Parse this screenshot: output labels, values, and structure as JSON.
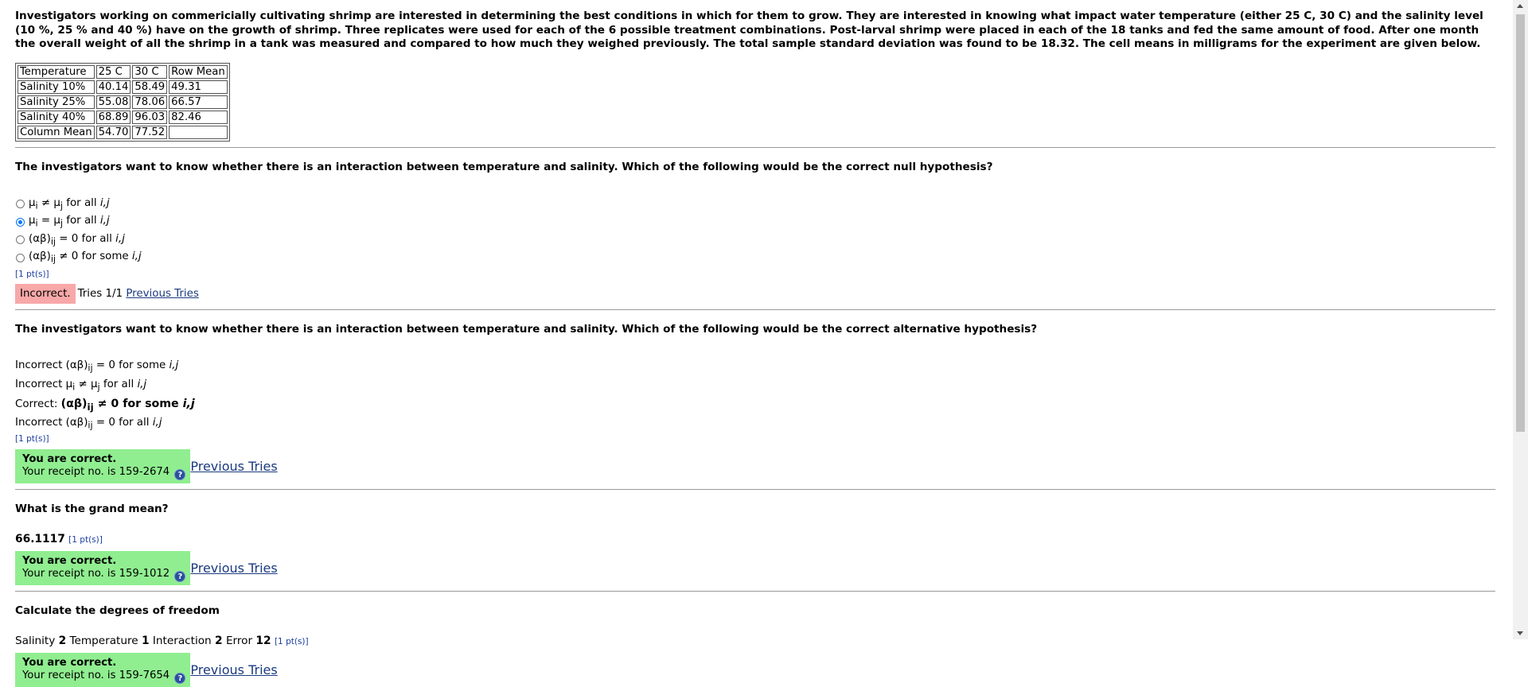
{
  "intro": "Investigators working on commericially cultivating shrimp are interested in determining the best conditions in which for them to grow. They are interested in knowing what impact water temperature (either 25 C, 30 C) and the salinity level (10 %, 25 % and 40 %) have on the growth of shrimp. Three replicates were used for each of the 6 possible treatment combinations. Post-larval shrimp were placed in each of the 18 tanks and fed the same amount of food. After one month the overall weight of all the shrimp in a tank was measured and compared to how much they weighed previously. The total sample standard deviation was found to be 18.32. The cell means in milligrams for the experiment are given below.",
  "table": {
    "header": [
      "Temperature",
      "25 C",
      "30 C",
      "Row Mean"
    ],
    "rows": [
      [
        "Salinity 10%",
        "40.14",
        "58.49",
        "49.31"
      ],
      [
        "Salinity 25%",
        "55.08",
        "78.06",
        "66.57"
      ],
      [
        "Salinity 40%",
        "68.89",
        "96.03",
        "82.46"
      ],
      [
        "Column Mean",
        "54.70",
        "77.52",
        ""
      ]
    ]
  },
  "q1": {
    "text": "The investigators want to know whether there is an interaction between temperature and salinity. Which of the following would be the correct null hypothesis?",
    "options": [
      {
        "prefix": "μ",
        "sub1": "i",
        "op": " ≠ μ",
        "sub2": "j",
        "suffix": " for all ",
        "vars": "i,j",
        "checked": false
      },
      {
        "prefix": "μ",
        "sub1": "i",
        "op": " = μ",
        "sub2": "j",
        "suffix": " for all ",
        "vars": "i,j",
        "checked": true
      },
      {
        "prefix": "(αβ)",
        "sub1": "ij",
        "op": " = 0 for all ",
        "vars": "i,j",
        "checked": false
      },
      {
        "prefix": "(αβ)",
        "sub1": "ij",
        "op": " ≠ 0 for some ",
        "vars": "i,j",
        "checked": false
      }
    ],
    "points": "[1 pt(s)]",
    "status": "Incorrect.",
    "tries": "Tries 1/1",
    "prev": "Previous Tries"
  },
  "q2": {
    "text": "The investigators want to know whether there is an interaction between temperature and salinity. Which of the following would be the correct alternative hypothesis?",
    "lines": [
      {
        "label": "Incorrect",
        "expr": "(αβ)",
        "sub": "ij",
        "rest": " = 0 for some ",
        "vars": "i,j"
      },
      {
        "label": "Incorrect",
        "expr": "μ",
        "sub": "i",
        "rest": " ≠ μ",
        "sub2": "j",
        "rest2": " for all ",
        "vars": "i,j"
      },
      {
        "label": "Correct:",
        "expr": "(αβ)",
        "sub": "ij",
        "rest": " ≠ 0 for some ",
        "vars": "i,j"
      },
      {
        "label": "Incorrect",
        "expr": "(αβ)",
        "sub": "ij",
        "rest": " = 0 for all ",
        "vars": "i,j"
      }
    ],
    "points": "[1 pt(s)]",
    "correct_title": "You are correct.",
    "receipt": "Your receipt no. is 159-2674",
    "prev": "Previous Tries"
  },
  "q3": {
    "text": "What is the grand mean?",
    "answer": "66.1117",
    "points": "[1 pt(s)]",
    "correct_title": "You are correct.",
    "receipt": "Your receipt no. is 159-1012",
    "prev": "Previous Tries"
  },
  "q4": {
    "text": "Calculate the degrees of freedom",
    "labels": [
      "Salinity",
      "Temperature",
      "Interaction",
      "Error"
    ],
    "values": [
      "2",
      "1",
      "2",
      "12"
    ],
    "points": "[1 pt(s)]",
    "correct_title": "You are correct.",
    "receipt": "Your receipt no. is 159-7654",
    "prev": "Previous Tries"
  },
  "icons": {
    "help": "help-icon",
    "radio": "radio-button"
  },
  "colors": {
    "correct_bg": "#90ee90",
    "incorrect_bg": "#f8a8a8",
    "link": "#1a3a80",
    "points": "#1a3c9f"
  }
}
